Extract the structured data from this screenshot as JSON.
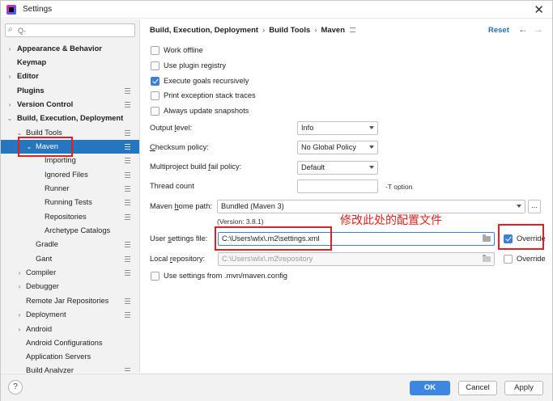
{
  "window": {
    "title": "Settings"
  },
  "search": {
    "placeholder": "Q-",
    "value": ""
  },
  "sidebar": {
    "items": [
      {
        "label": "Appearance & Behavior",
        "arrow": "›",
        "bold": true
      },
      {
        "label": "Keymap",
        "bold": true
      },
      {
        "label": "Editor",
        "arrow": "›",
        "bold": true
      },
      {
        "label": "Plugins",
        "bold": true
      },
      {
        "label": "Version Control",
        "arrow": "›",
        "bold": true
      },
      {
        "label": "Build, Execution, Deployment",
        "arrow": "⌄",
        "bold": true
      },
      {
        "label": "Build Tools",
        "arrow": "⌄"
      },
      {
        "label": "Maven",
        "arrow": "⌄",
        "selected": true
      },
      {
        "label": "Importing"
      },
      {
        "label": "Ignored Files"
      },
      {
        "label": "Runner"
      },
      {
        "label": "Running Tests"
      },
      {
        "label": "Repositories"
      },
      {
        "label": "Archetype Catalogs"
      },
      {
        "label": "Gradle"
      },
      {
        "label": "Gant"
      },
      {
        "label": "Compiler",
        "arrow": "›"
      },
      {
        "label": "Debugger",
        "arrow": "›"
      },
      {
        "label": "Remote Jar Repositories"
      },
      {
        "label": "Deployment",
        "arrow": "›"
      },
      {
        "label": "Android",
        "arrow": "›"
      },
      {
        "label": "Android Configurations"
      },
      {
        "label": "Application Servers"
      },
      {
        "label": "Build Analyzer"
      }
    ]
  },
  "breadcrumb": {
    "part1": "Build, Execution, Deployment",
    "sep": "›",
    "part2": "Build Tools",
    "part3": "Maven"
  },
  "header": {
    "reset": "Reset"
  },
  "options": {
    "work_offline": {
      "label": "Work offline",
      "checked": false
    },
    "plugin_registry": {
      "label": "Use plugin registry",
      "checked": false
    },
    "execute_recursively": {
      "label": "Execute goals recursively",
      "checked": true
    },
    "print_stack": {
      "label": "Print exception stack traces",
      "checked": false
    },
    "update_snapshots": {
      "label": "Always update snapshots",
      "checked": false
    }
  },
  "fields": {
    "output_level": {
      "label_pre": "Output ",
      "label_u": "l",
      "label_post": "evel:",
      "value": "Info"
    },
    "checksum": {
      "label_pre": "",
      "label_u": "C",
      "label_post": "hecksum policy:",
      "value": "No Global Policy"
    },
    "fail_policy": {
      "label_pre": "Multiproject build ",
      "label_u": "f",
      "label_post": "ail policy:",
      "value": "Default"
    },
    "thread_count": {
      "label": "Thread count",
      "value": "",
      "note": "-T option"
    },
    "maven_home": {
      "label_pre": "Maven ",
      "label_u": "h",
      "label_post": "ome path:",
      "value": "Bundled (Maven 3)",
      "button": "...",
      "version": "(Version: 3.8.1)"
    },
    "user_settings": {
      "label_pre": "User ",
      "label_u": "s",
      "label_post": "ettings file:",
      "value": "C:\\Users\\wlx\\.m2\\settings.xml",
      "override_label": "Override",
      "override_checked": true
    },
    "local_repo": {
      "label_pre": "Local ",
      "label_u": "r",
      "label_post": "epository:",
      "value": "C:\\Users\\wlx\\.m2\\repository",
      "override_label": "Override",
      "override_checked": false
    },
    "mvn_config": {
      "label": "Use settings from .mvn/maven.config",
      "checked": false
    }
  },
  "annotation": {
    "text": "修改此处的配置文件",
    "color": "#e02020"
  },
  "footer": {
    "help": "?",
    "ok": "OK",
    "cancel": "Cancel",
    "apply": "Apply"
  },
  "colors": {
    "accent": "#2675bf",
    "annotation": "#e02020",
    "primary_button": "#3d87e0"
  }
}
